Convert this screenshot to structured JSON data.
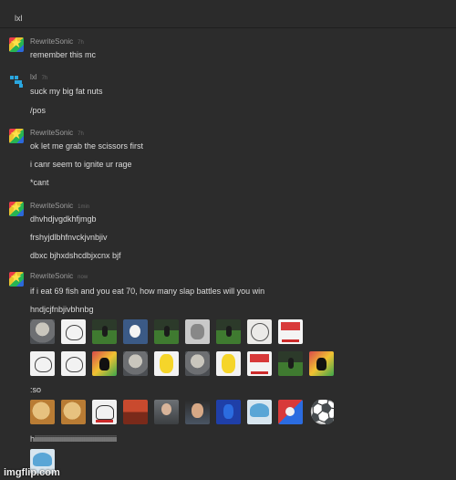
{
  "header": {
    "title": "lxl"
  },
  "messages": [
    {
      "author": "RewriteSonic",
      "time": "7h",
      "lines": [
        "remember this mc"
      ]
    },
    {
      "author": "lxl",
      "time": "7h",
      "lines": [
        "suck my big fat nuts",
        "/pos"
      ]
    },
    {
      "author": "RewriteSonic",
      "time": "7h",
      "lines": [
        "ok let me grab the scissors first",
        "i canr seem to ignite ur rage",
        "*cant"
      ]
    },
    {
      "author": "RewriteSonic",
      "time": "1min",
      "lines": [
        "dhvhdjvgdkhfjmgb",
        "frshyjdlbhfnvckjvnbjiv",
        "dbxc bjhxdshcdbjxcnx bjf"
      ]
    },
    {
      "author": "RewriteSonic",
      "time": "now",
      "lines": [
        "if i eat 69 fish and you eat 70, how many slap battles will you win",
        "hndjcjfnbjivbhnbg",
        ":so",
        "hiiiiiiiiiiiiiiiiiiiiiiiiiiiiiiiiiiiiiiiiiiiii"
      ]
    }
  ],
  "emoji_rows": [
    [
      "seal-emoji",
      "troll-emoji",
      "soccer-field-emoji",
      "blue-face-emoji",
      "soccer-field-emoji",
      "gray-face-emoji",
      "soccer-field-emoji",
      "crying-meme-emoji",
      "rage-face-emoji"
    ],
    [
      "troll-emoji",
      "troll-emoji",
      "cat-emoji",
      "seal-emoji",
      "yellow-cartoon-emoji",
      "seal-emoji",
      "yellow-cartoon-emoji",
      "rage-face-emoji",
      "soccer-field-emoji",
      "cat-emoji"
    ],
    [
      "doge-emoji",
      "doge-emoji",
      "table-flip-emoji",
      "cars-emoji",
      "old-man-emoji",
      "face-photo-emoji",
      "sonic-pixel-emoji",
      "shark-emoji",
      "red-blue-emoji",
      "soccer-ball-emoji"
    ],
    [
      "shark-emoji"
    ]
  ],
  "watermark": "imgflip.com"
}
